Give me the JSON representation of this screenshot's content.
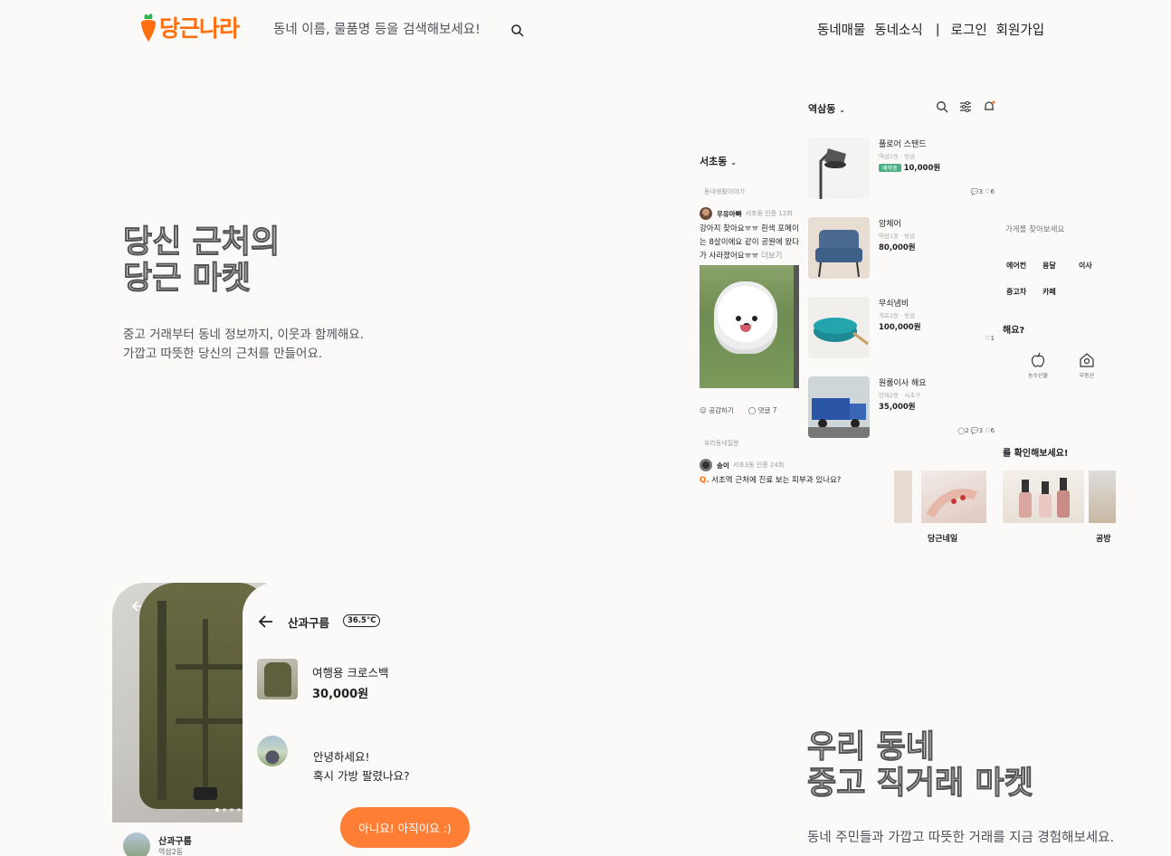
{
  "header": {
    "logo_text": "당근나라",
    "search_placeholder": "동네 이름, 물품명 등을 검색해보세요!",
    "nav": [
      "동네매물",
      "동네소식"
    ],
    "separator": "|",
    "login": "로그인",
    "signup": "회원가입"
  },
  "hero1": {
    "title_line1": "당신 근처의",
    "title_line2": "당근 마켓",
    "desc_line1": "중고 거래부터 동네 정보까지, 이웃과 함께해요.",
    "desc_line2": "가깝고 따뜻한 당신의 근처를 만들어요."
  },
  "hero2": {
    "title_line1": "우리 동네",
    "title_line2": "중고 직거래 마켓",
    "desc": "동네 주민들과 가깝고 따뜻한 거래를 지금 경험해보세요."
  },
  "community": {
    "location": "서초동",
    "category1": "동네생활이야기",
    "post_author": "우유아빠",
    "post_author_meta": "서초동 인증 12회",
    "post_body": "강아지 찾아요ㅠㅠ 흰색 포메이는 8살이에요 같이 공원에 왔다가 사라졌어요ㅠㅠ",
    "post_more": "더보기",
    "like_label": "공감하기",
    "comment_label": "댓글 7",
    "category2": "우리동네질문",
    "q_author": "송이",
    "q_author_meta": "서초3동 인증 24회",
    "q_prefix": "Q.",
    "q_text": "서초역 근처에 진료 보는 피부과 있나요?"
  },
  "listing": {
    "location": "역삼동",
    "items": [
      {
        "title": "플로어 스탠드",
        "sub": "역삼2동 · 방금",
        "badge": "예약중",
        "price": "10,000원",
        "stats": "💬3 ♡6"
      },
      {
        "title": "암체어",
        "sub": "역삼1동 · 방금",
        "badge": "",
        "price": "80,000원",
        "stats": ""
      },
      {
        "title": "무쇠냄비",
        "sub": "개포2동 · 방금",
        "badge": "",
        "price": "100,000원",
        "stats": "♡1"
      },
      {
        "title": "원룸이사 해요",
        "sub": "양재2동 · 서초구",
        "badge": "",
        "price": "35,000원",
        "stats": "◯2 💬3 ♡6"
      }
    ]
  },
  "stores": {
    "search_placeholder": "가게를 찾아보세요",
    "categories": [
      "에어컨",
      "용달",
      "이사",
      "중고차",
      "카페"
    ],
    "question": "해요?",
    "icon_labels": [
      "농수산물",
      "부동산"
    ],
    "check_text": "를 확인해보세요!",
    "store_labels": [
      "당근네일",
      "공방"
    ]
  },
  "chat": {
    "partner_name": "산과구름",
    "temperature": "36.5°C",
    "item_title": "여행용 크로스백",
    "item_price": "30,000원",
    "message_line1": "안녕하세요!",
    "message_line2": "혹시 가방 팔렸나요?",
    "reply_button": "아니요! 아직이요 :)",
    "seller_name": "산과구름",
    "seller_location": "역삼2동"
  }
}
